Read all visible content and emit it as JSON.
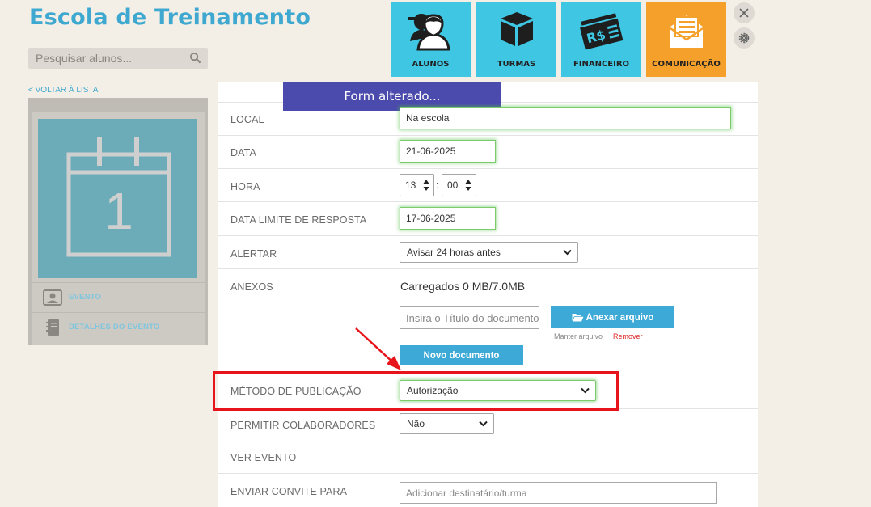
{
  "app": {
    "title": "Escola de Treinamento"
  },
  "search": {
    "placeholder": "Pesquisar alunos..."
  },
  "nav": [
    {
      "label": "ALUNOS",
      "icon": "students-icon"
    },
    {
      "label": "TURMAS",
      "icon": "box-icon"
    },
    {
      "label": "FINANCEIRO",
      "icon": "money-icon"
    },
    {
      "label": "COMUNICAÇÃO",
      "icon": "envelope-icon",
      "active": true
    }
  ],
  "sidebar": {
    "back_link": "< VOLTAR À LISTA",
    "calendar_day": "1",
    "items": [
      {
        "label": "EVENTO",
        "icon": "user-card-icon"
      },
      {
        "label": "DETALHES DO EVENTO",
        "icon": "notebook-icon"
      }
    ]
  },
  "banner": {
    "text": "Form alterado..."
  },
  "form": {
    "local": {
      "label": "LOCAL",
      "value": "Na escola"
    },
    "data": {
      "label": "DATA",
      "value": "21-06-2025"
    },
    "hora": {
      "label": "HORA",
      "hour": "13",
      "minute": "00",
      "separator": ":"
    },
    "data_limite": {
      "label": "DATA LIMITE DE RESPOSTA",
      "value": "17-06-2025"
    },
    "alertar": {
      "label": "ALERTAR",
      "value": "Avisar 24 horas antes"
    },
    "anexos": {
      "label": "ANEXOS",
      "loaded": "Carregados 0 MB/7.0MB",
      "title_placeholder": "Insira o Título do documento",
      "attach_button": "Anexar arquivo",
      "keep_link": "Manter arquivo",
      "remove_link": "Remover",
      "new_doc_button": "Novo documento"
    },
    "metodo": {
      "label": "MÉTODO DE PUBLICAÇÃO",
      "value": "Autorização"
    },
    "permitir": {
      "label": "PERMITIR COLABORADORES",
      "value": "Não"
    },
    "ver_evento": {
      "label": "VER EVENTO"
    },
    "enviar": {
      "label": "ENVIAR CONVITE PARA",
      "placeholder": "Adicionar destinatário/turma"
    }
  },
  "colors": {
    "accent": "#3fa8d0",
    "nav": "#3ec6e3",
    "active_nav": "#f5a02a",
    "banner": "#4b4aad",
    "highlight": "#e8141b"
  }
}
